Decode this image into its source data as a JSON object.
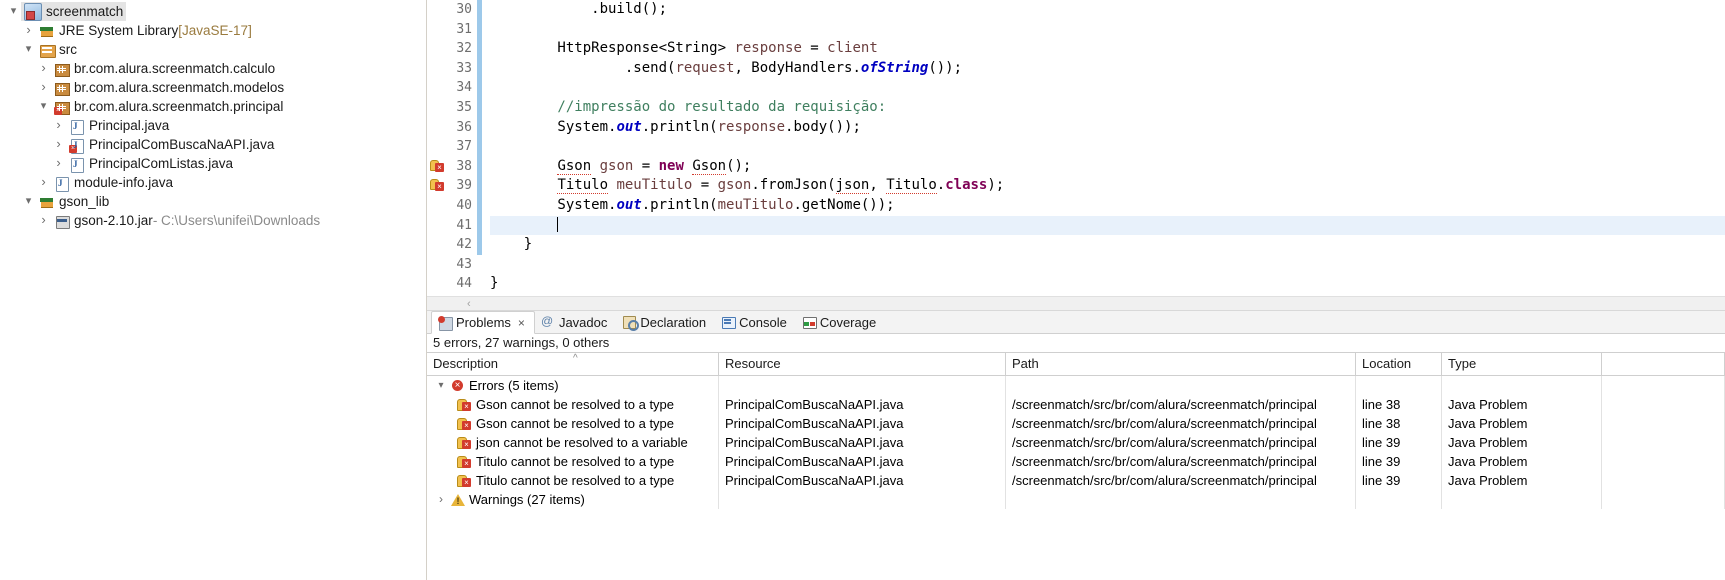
{
  "explorer": {
    "name": "package-explorer",
    "items": [
      {
        "label": "screenmatch",
        "suffix": "",
        "indent": 0,
        "twisty": "open",
        "icon": "project-icon",
        "selected": true
      },
      {
        "label": "JRE System Library",
        "suffix": " [JavaSE-17]",
        "indent": 1,
        "twisty": "closed",
        "icon": "library-icon",
        "selected": false
      },
      {
        "label": "src",
        "suffix": "",
        "indent": 1,
        "twisty": "open",
        "icon": "source-folder-icon",
        "selected": false
      },
      {
        "label": "br.com.alura.screenmatch.calculo",
        "suffix": "",
        "indent": 2,
        "twisty": "closed",
        "icon": "package-icon",
        "selected": false
      },
      {
        "label": "br.com.alura.screenmatch.modelos",
        "suffix": "",
        "indent": 2,
        "twisty": "closed",
        "icon": "package-icon",
        "selected": false
      },
      {
        "label": "br.com.alura.screenmatch.principal",
        "suffix": "",
        "indent": 2,
        "twisty": "open",
        "icon": "package-error-icon",
        "selected": false
      },
      {
        "label": "Principal.java",
        "suffix": "",
        "indent": 3,
        "twisty": "closed",
        "icon": "java-file-icon",
        "selected": false
      },
      {
        "label": "PrincipalComBuscaNaAPI.java",
        "suffix": "",
        "indent": 3,
        "twisty": "closed",
        "icon": "java-file-error-icon",
        "selected": false
      },
      {
        "label": "PrincipalComListas.java",
        "suffix": "",
        "indent": 3,
        "twisty": "closed",
        "icon": "java-file-icon",
        "selected": false
      },
      {
        "label": "module-info.java",
        "suffix": "",
        "indent": 2,
        "twisty": "closed",
        "icon": "java-file-icon",
        "selected": false
      },
      {
        "label": "gson_lib",
        "suffix": "",
        "indent": 1,
        "twisty": "open",
        "icon": "library-icon",
        "selected": false
      },
      {
        "label": "gson-2.10.jar",
        "suffix": " - C:\\Users\\unifei\\Downloads",
        "indent": 2,
        "twisty": "closed",
        "icon": "jar-icon",
        "selected": false
      }
    ]
  },
  "editor": {
    "name": "java-editor",
    "first_line": 30,
    "current_line": 41,
    "error_lines": [
      38,
      39
    ],
    "lines": [
      {
        "num": 30,
        "tokens": [
          {
            "t": "            .build();",
            "c": "plain"
          }
        ]
      },
      {
        "num": 31,
        "tokens": [
          {
            "t": "",
            "c": "plain"
          }
        ]
      },
      {
        "num": 32,
        "tokens": [
          {
            "t": "        HttpResponse<String> ",
            "c": "plain"
          },
          {
            "t": "response",
            "c": "loc"
          },
          {
            "t": " = ",
            "c": "plain"
          },
          {
            "t": "client",
            "c": "loc"
          }
        ]
      },
      {
        "num": 33,
        "tokens": [
          {
            "t": "                .send(",
            "c": "plain"
          },
          {
            "t": "request",
            "c": "loc"
          },
          {
            "t": ", BodyHandlers.",
            "c": "plain"
          },
          {
            "t": "ofString",
            "c": "fieldst"
          },
          {
            "t": "());",
            "c": "plain"
          }
        ]
      },
      {
        "num": 34,
        "tokens": [
          {
            "t": "",
            "c": "plain"
          }
        ]
      },
      {
        "num": 35,
        "tokens": [
          {
            "t": "        //impressão do resultado da requisição:",
            "c": "cm"
          }
        ]
      },
      {
        "num": 36,
        "tokens": [
          {
            "t": "        System.",
            "c": "plain"
          },
          {
            "t": "out",
            "c": "fieldst"
          },
          {
            "t": ".println(",
            "c": "plain"
          },
          {
            "t": "response",
            "c": "loc"
          },
          {
            "t": ".body());",
            "c": "plain"
          }
        ]
      },
      {
        "num": 37,
        "tokens": [
          {
            "t": "",
            "c": "plain"
          }
        ]
      },
      {
        "num": 38,
        "tokens": [
          {
            "t": "        ",
            "c": "plain"
          },
          {
            "t": "Gson",
            "c": "err"
          },
          {
            "t": " ",
            "c": "plain"
          },
          {
            "t": "gson",
            "c": "loc"
          },
          {
            "t": " = ",
            "c": "plain"
          },
          {
            "t": "new",
            "c": "kw"
          },
          {
            "t": " ",
            "c": "plain"
          },
          {
            "t": "Gson",
            "c": "err"
          },
          {
            "t": "();",
            "c": "plain"
          }
        ]
      },
      {
        "num": 39,
        "tokens": [
          {
            "t": "        ",
            "c": "plain"
          },
          {
            "t": "Titulo",
            "c": "err"
          },
          {
            "t": " ",
            "c": "plain"
          },
          {
            "t": "meuTitulo",
            "c": "loc"
          },
          {
            "t": " = ",
            "c": "plain"
          },
          {
            "t": "gson",
            "c": "loc"
          },
          {
            "t": ".fromJson(",
            "c": "plain"
          },
          {
            "t": "json",
            "c": "err"
          },
          {
            "t": ", ",
            "c": "plain"
          },
          {
            "t": "Titulo",
            "c": "err"
          },
          {
            "t": ".",
            "c": "plain"
          },
          {
            "t": "class",
            "c": "kw"
          },
          {
            "t": ");",
            "c": "plain"
          }
        ]
      },
      {
        "num": 40,
        "tokens": [
          {
            "t": "        System.",
            "c": "plain"
          },
          {
            "t": "out",
            "c": "fieldst"
          },
          {
            "t": ".println(",
            "c": "plain"
          },
          {
            "t": "meuTitulo",
            "c": "loc"
          },
          {
            "t": ".getNome());",
            "c": "plain"
          }
        ]
      },
      {
        "num": 41,
        "tokens": [
          {
            "t": "        ",
            "c": "plain"
          }
        ]
      },
      {
        "num": 42,
        "tokens": [
          {
            "t": "    }",
            "c": "plain"
          }
        ]
      },
      {
        "num": 43,
        "tokens": [
          {
            "t": "",
            "c": "plain"
          }
        ]
      },
      {
        "num": 44,
        "tokens": [
          {
            "t": "}",
            "c": "plain"
          }
        ]
      }
    ],
    "hscroll_marker": "‹"
  },
  "bottom_view": {
    "tabs": [
      {
        "label": "Problems",
        "icon": "problems-icon",
        "active": true,
        "closeable": true,
        "close_glyph": "×"
      },
      {
        "label": "Javadoc",
        "icon": "javadoc-icon",
        "active": false,
        "closeable": false
      },
      {
        "label": "Declaration",
        "icon": "declaration-icon",
        "active": false,
        "closeable": false
      },
      {
        "label": "Console",
        "icon": "console-icon",
        "active": false,
        "closeable": false
      },
      {
        "label": "Coverage",
        "icon": "coverage-icon",
        "active": false,
        "closeable": false
      }
    ],
    "summary": "5 errors, 27 warnings, 0 others",
    "columns": [
      "Description",
      "Resource",
      "Path",
      "Location",
      "Type"
    ],
    "sort_indicator": "^",
    "groups": [
      {
        "label": "Errors (5 items)",
        "severity": "error",
        "twisty": "open",
        "rows": [
          {
            "description": "Gson cannot be resolved to a type",
            "resource": "PrincipalComBuscaNaAPI.java",
            "path": "/screenmatch/src/br/com/alura/screenmatch/principal",
            "location": "line 38",
            "type": "Java Problem"
          },
          {
            "description": "Gson cannot be resolved to a type",
            "resource": "PrincipalComBuscaNaAPI.java",
            "path": "/screenmatch/src/br/com/alura/screenmatch/principal",
            "location": "line 38",
            "type": "Java Problem"
          },
          {
            "description": "json cannot be resolved to a variable",
            "resource": "PrincipalComBuscaNaAPI.java",
            "path": "/screenmatch/src/br/com/alura/screenmatch/principal",
            "location": "line 39",
            "type": "Java Problem"
          },
          {
            "description": "Titulo cannot be resolved to a type",
            "resource": "PrincipalComBuscaNaAPI.java",
            "path": "/screenmatch/src/br/com/alura/screenmatch/principal",
            "location": "line 39",
            "type": "Java Problem"
          },
          {
            "description": "Titulo cannot be resolved to a type",
            "resource": "PrincipalComBuscaNaAPI.java",
            "path": "/screenmatch/src/br/com/alura/screenmatch/principal",
            "location": "line 39",
            "type": "Java Problem"
          }
        ]
      },
      {
        "label": "Warnings (27 items)",
        "severity": "warning",
        "twisty": "closed",
        "rows": []
      }
    ]
  },
  "colors": {
    "selection": "#e4e4e4",
    "current_line": "#e8f1fb",
    "error": "#d23b2d",
    "warning": "#e8b53a",
    "keyword": "#7f0055",
    "comment": "#3f7f5f",
    "static_field": "#0000c0",
    "local_var": "#6a3e3e",
    "change_bar": "#9dc9ea"
  }
}
